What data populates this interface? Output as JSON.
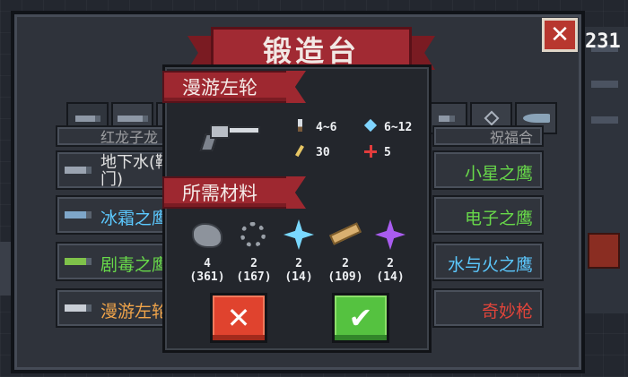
{
  "forge": {
    "title": "锻造台",
    "close_label": "✕",
    "counter": "231"
  },
  "list_rows": {
    "left": [
      {
        "name": "红龙子龙",
        "color": "#e2e2e2"
      },
      {
        "name": "地下水(靴门)",
        "line1": "地下水(靴",
        "line2": "门)",
        "color": "#e2e2e2"
      },
      {
        "name": "冰霜之鹰",
        "color": "#5cc9ff"
      },
      {
        "name": "剧毒之鹰",
        "color": "#68d94a"
      },
      {
        "name": "漫游左轮",
        "color": "#f0a44a"
      }
    ],
    "right": [
      {
        "name": "祝福合",
        "color": "#e2e2e2"
      },
      {
        "name": "小星之鹰",
        "color": "#68d94a"
      },
      {
        "name": "电子之鹰",
        "color": "#68d94a"
      },
      {
        "name": "水与火之鹰",
        "color": "#5cc9ff"
      },
      {
        "name": "奇妙枪",
        "color": "#e0443a"
      }
    ]
  },
  "popup": {
    "weapon_name": "漫游左轮",
    "materials_heading": "所需材料",
    "stats": {
      "damage": "4~6",
      "energy": "6~12",
      "crit": "30",
      "precision": "5"
    },
    "materials": [
      {
        "icon": "ore-icon",
        "need": "4",
        "have": "(361)"
      },
      {
        "icon": "gear-icon",
        "need": "2",
        "have": "(167)"
      },
      {
        "icon": "blue-crystal-icon",
        "need": "2",
        "have": "(14)"
      },
      {
        "icon": "plank-icon",
        "need": "2",
        "have": "(109)"
      },
      {
        "icon": "purple-crystal-icon",
        "need": "2",
        "have": "(14)"
      }
    ],
    "cancel_label": "✕",
    "confirm_label": "✔"
  },
  "colors": {
    "banner_red": "#a12a33",
    "cancel_red": "#e0432e",
    "confirm_green": "#55c240"
  }
}
